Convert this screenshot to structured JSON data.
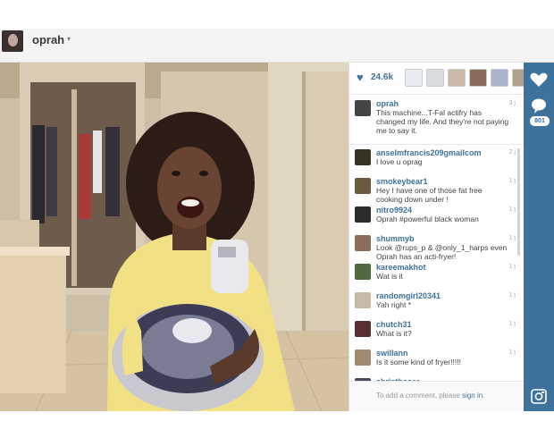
{
  "header": {
    "username": "oprah",
    "caret": "▾"
  },
  "likes": {
    "icon": "heart-icon",
    "count": "24.6k",
    "liker_colors": [
      "#e9edf1",
      "#d9dde2",
      "#c9b9a9",
      "#8a6a5a",
      "#a7b4c9",
      "#b0a08e",
      "#d5c3b2"
    ]
  },
  "caption": {
    "user": "oprah",
    "text": "This machine...T-Fal actifry has changed my life. And they're not paying me to say it.",
    "time": "3 j"
  },
  "comments": [
    {
      "user": "anselmfrancis209gmailcom",
      "text": "I love u oprag",
      "time": "2 j"
    },
    {
      "user": "smokeybear1",
      "text": "Hey I have one of those fat free cooking down under !",
      "time": "1 j"
    },
    {
      "user": "nitro9924",
      "text": "Oprah #powerful black woman",
      "time": "1 j"
    },
    {
      "user": "shummyb",
      "text": "Look @rups_p & @only_1_harps even Oprah has an acti-fryer!",
      "time": "1 j"
    },
    {
      "user": "kareemakhot",
      "text": "Wat is it",
      "time": "1 j"
    },
    {
      "user": "randomgirl20341",
      "text": "Yah right *",
      "time": "1 j"
    },
    {
      "user": "chutch31",
      "text": "What is it?",
      "time": "1 j"
    },
    {
      "user": "swillann",
      "text": "Is it some kind of fryer!!!!!",
      "time": "1 j"
    },
    {
      "user": "christbaser",
      "text": "",
      "time": ""
    }
  ],
  "add_comment": {
    "prefix": "To add a comment, please ",
    "link": "sign in",
    "suffix": "."
  },
  "rail": {
    "like_icon": "heart-icon",
    "comment_icon": "speech-bubble-icon",
    "comment_count": "801",
    "logo_icon": "instagram-camera-icon"
  },
  "colors": {
    "accent": "#3f729b",
    "rail": "#3f729b"
  }
}
